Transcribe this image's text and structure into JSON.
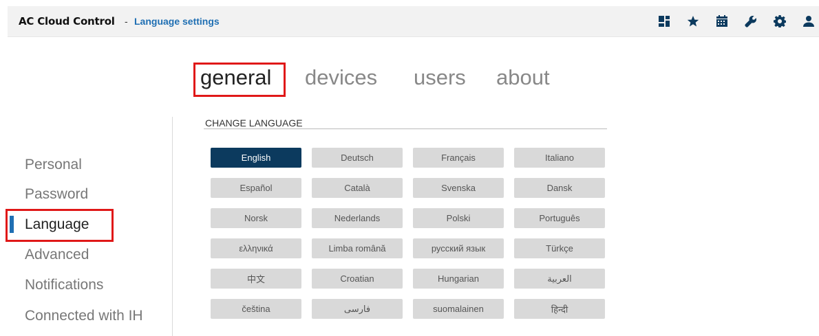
{
  "header": {
    "app_title": "AC Cloud Control",
    "separator": "-",
    "page_title": "Language settings",
    "icons": [
      "dashboard-icon",
      "star-icon",
      "calendar-icon",
      "wrench-icon",
      "gear-icon",
      "user-icon"
    ]
  },
  "tabs": [
    {
      "label": "general",
      "active": true
    },
    {
      "label": "devices",
      "active": false
    },
    {
      "label": "users",
      "active": false
    },
    {
      "label": "about",
      "active": false
    }
  ],
  "sidebar": {
    "items": [
      {
        "label": "Personal",
        "active": false
      },
      {
        "label": "Password",
        "active": false
      },
      {
        "label": "Language",
        "active": true
      },
      {
        "label": "Advanced",
        "active": false
      },
      {
        "label": "Notifications",
        "active": false
      },
      {
        "label": "Connected with IH",
        "active": false
      }
    ]
  },
  "section": {
    "title": "CHANGE LANGUAGE",
    "selected": "English",
    "languages": [
      "English",
      "Deutsch",
      "Français",
      "Italiano",
      "Español",
      "Català",
      "Svenska",
      "Dansk",
      "Norsk",
      "Nederlands",
      "Polski",
      "Português",
      "ελληνικά",
      "Limba română",
      "русский язык",
      "Türkçe",
      "中文",
      "Croatian",
      "Hungarian",
      "العربية",
      "čeština",
      "فارسی",
      "suomalainen",
      "हिन्दी"
    ]
  },
  "colors": {
    "accent": "#1f6fb3",
    "selected_button": "#0c3a5e",
    "button": "#d9d9d9",
    "highlight_box": "#e01818"
  }
}
